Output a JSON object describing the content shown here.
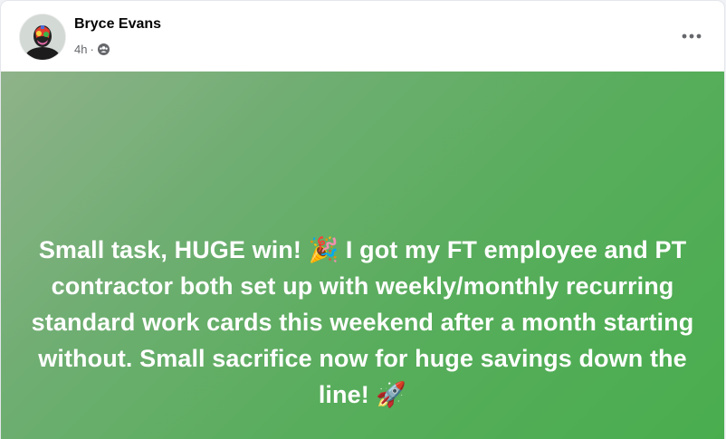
{
  "post": {
    "author": "Bryce Evans",
    "time": "4h",
    "separator": "·",
    "audience_icon": "friends-icon",
    "more_icon": "more-horizontal-icon",
    "background_colors": [
      "#8fb28a",
      "#49ad4e"
    ],
    "text": "Small task, HUGE win! 🎉 I got my FT employee and PT contractor both set up with weekly/monthly recurring standard work cards this weekend after a month starting without. Small sacrifice now for huge savings down the line! 🚀"
  }
}
